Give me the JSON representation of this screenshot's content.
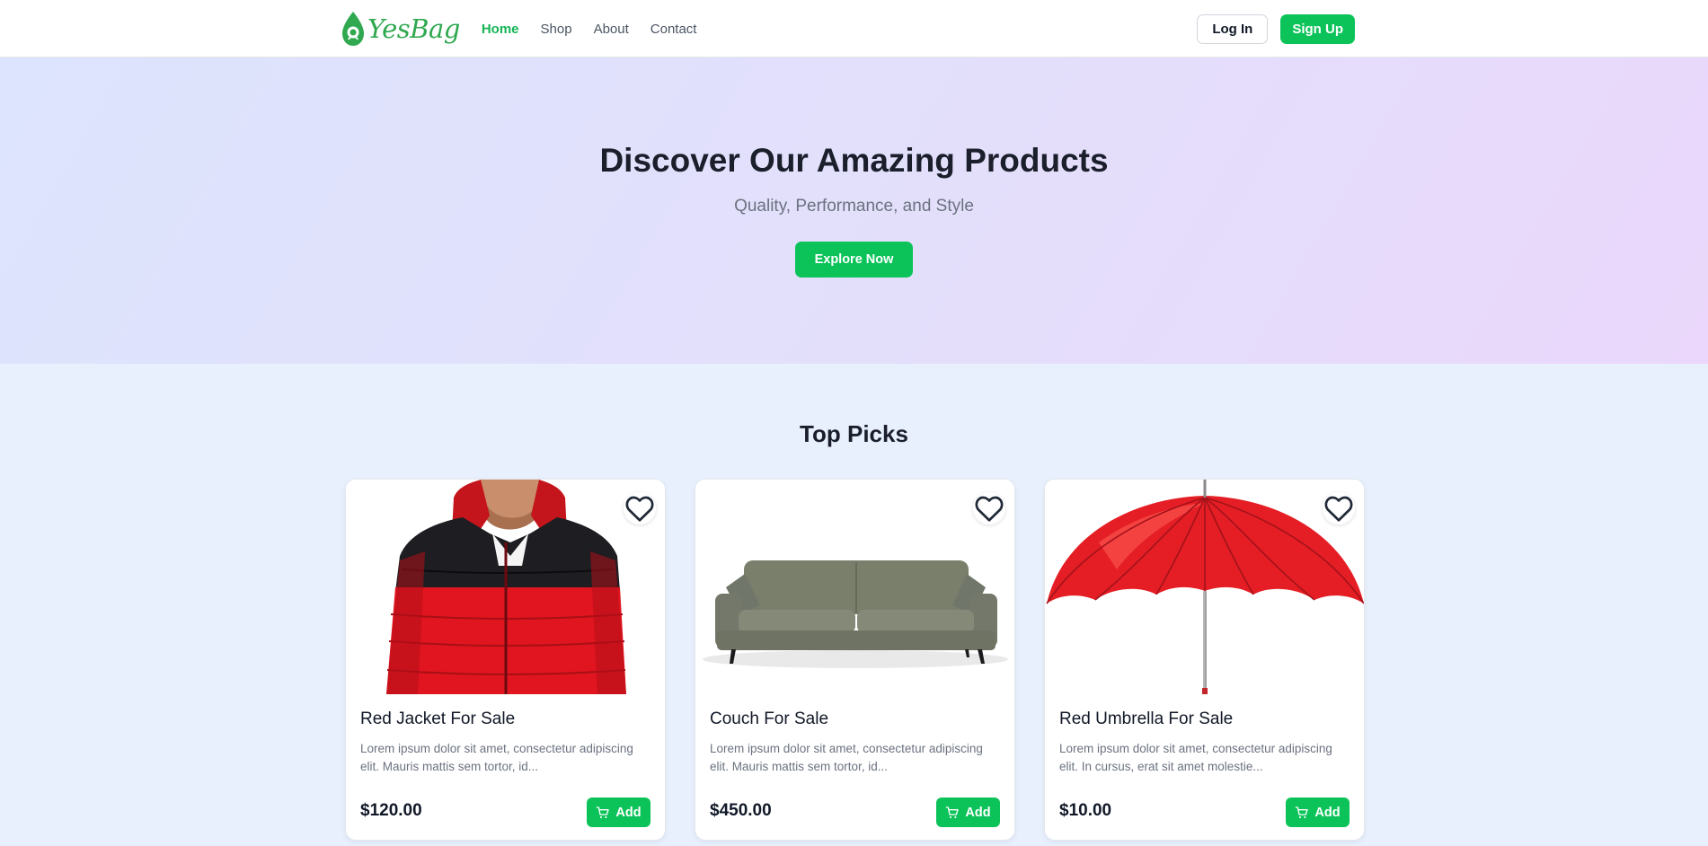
{
  "brand": {
    "name": "YesBag",
    "color": "#2fa84f"
  },
  "nav": {
    "items": [
      {
        "label": "Home",
        "active": true
      },
      {
        "label": "Shop",
        "active": false
      },
      {
        "label": "About",
        "active": false
      },
      {
        "label": "Contact",
        "active": false
      }
    ]
  },
  "auth": {
    "login_label": "Log In",
    "signup_label": "Sign Up"
  },
  "hero": {
    "title": "Discover Our Amazing Products",
    "subtitle": "Quality, Performance, and Style",
    "cta_label": "Explore Now"
  },
  "products": {
    "section_title": "Top Picks",
    "add_label": "Add",
    "items": [
      {
        "title": "Red Jacket For Sale",
        "description": "Lorem ipsum dolor sit amet, consectetur adipiscing elit. Mauris mattis sem tortor, id...",
        "price": "$120.00",
        "image": "red-jacket"
      },
      {
        "title": "Couch For Sale",
        "description": "Lorem ipsum dolor sit amet, consectetur adipiscing elit. Mauris mattis sem tortor, id...",
        "price": "$450.00",
        "image": "grey-couch"
      },
      {
        "title": "Red Umbrella For Sale",
        "description": "Lorem ipsum dolor sit amet, consectetur adipiscing elit. In cursus, erat sit amet molestie...",
        "price": "$10.00",
        "image": "red-umbrella"
      }
    ]
  },
  "colors": {
    "accent": "#0cc35a",
    "page_bg": "#e8f0fd",
    "hero_start": "#dde4fd",
    "hero_end": "#ead7fb"
  },
  "icons": {
    "favorite": "heart-icon",
    "cart": "cart-icon",
    "logo": "bag-logo-icon"
  }
}
